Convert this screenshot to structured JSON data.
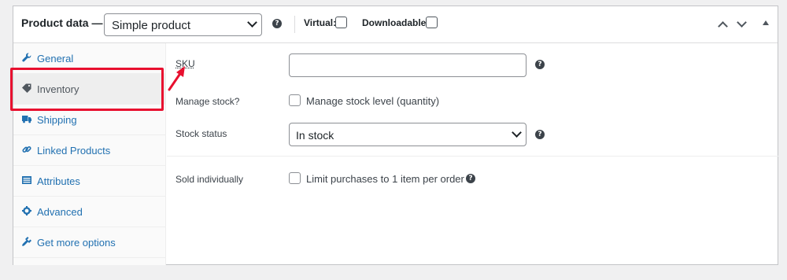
{
  "header": {
    "title": "Product data —",
    "product_type": "Simple product",
    "virtual_label": "Virtual:",
    "downloadable_label": "Downloadable:",
    "help_glyph": "?"
  },
  "sidebar": {
    "items": [
      {
        "label": "General",
        "icon": "wrench-icon"
      },
      {
        "label": "Inventory",
        "icon": "tag-icon",
        "active": true
      },
      {
        "label": "Shipping",
        "icon": "truck-icon"
      },
      {
        "label": "Linked Products",
        "icon": "link-icon"
      },
      {
        "label": "Attributes",
        "icon": "list-icon"
      },
      {
        "label": "Advanced",
        "icon": "gear-icon"
      },
      {
        "label": "Get more options",
        "icon": "plugin-icon"
      }
    ]
  },
  "inventory": {
    "sku_label": "SKU",
    "sku_value": "",
    "manage_stock_label": "Manage stock?",
    "manage_stock_text": "Manage stock level (quantity)",
    "stock_status_label": "Stock status",
    "stock_status_value": "In stock",
    "sold_individually_label": "Sold individually",
    "sold_individually_text": "Limit purchases to 1 item per order"
  },
  "colors": {
    "accent": "#2271b1",
    "highlight": "#e8102f"
  }
}
